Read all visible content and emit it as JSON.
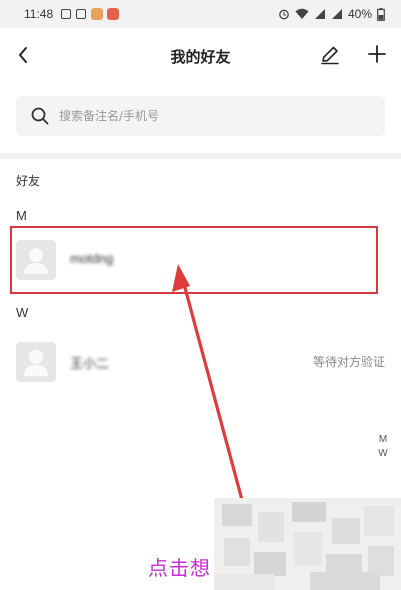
{
  "status_bar": {
    "time": "11:48",
    "battery_percent": "40%"
  },
  "nav": {
    "title": "我的好友",
    "back_icon": "chevron-left-icon",
    "edit_icon": "pencil-icon",
    "add_icon": "plus-icon"
  },
  "search": {
    "placeholder": "搜索备注名/手机号",
    "icon": "search-icon"
  },
  "friends_section": {
    "label": "好友",
    "groups": [
      {
        "letter": "M",
        "items": [
          {
            "name": "motdng",
            "status": ""
          }
        ]
      },
      {
        "letter": "W",
        "items": [
          {
            "name": "王小二",
            "status": "等待对方验证"
          }
        ]
      }
    ]
  },
  "index_bar": [
    "M",
    "W"
  ],
  "annotation": {
    "caption": "点击想",
    "color": "#d9363e",
    "caption_color": "#c82bd8"
  },
  "colors": {
    "background": "#ffffff",
    "search_bg": "#f4f4f4",
    "divider": "#f2f2f2",
    "avatar_bg": "#e6e6e6"
  }
}
